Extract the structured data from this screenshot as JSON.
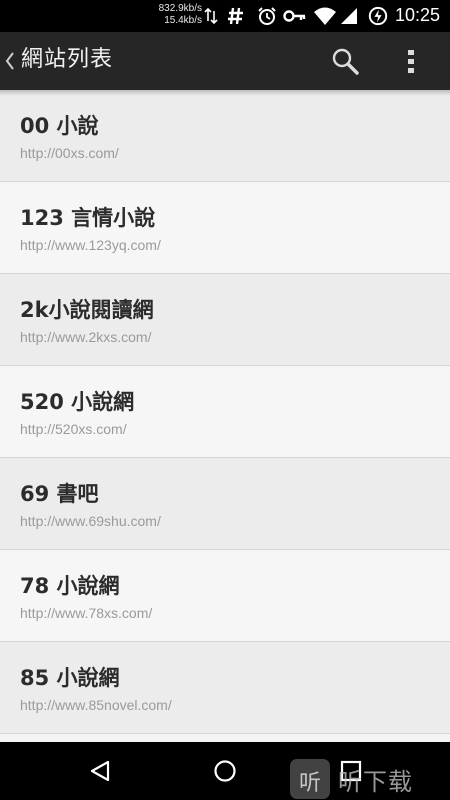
{
  "status_bar": {
    "speed_down": "832.9kb/s",
    "speed_up": "15.4kb/s",
    "time": "10:25",
    "icons": [
      "data-arrows-icon",
      "hash-icon",
      "alarm-icon",
      "vpn-key-icon",
      "wifi-icon",
      "signal-icon",
      "battery-charging-icon"
    ]
  },
  "action_bar": {
    "title": "網站列表",
    "back_icon": "chevron-left-icon",
    "search_icon": "search-icon",
    "overflow_icon": "overflow-menu-icon"
  },
  "sites": [
    {
      "name": "00 小說",
      "url": "http://00xs.com/"
    },
    {
      "name": "123 言情小說",
      "url": "http://www.123yq.com/"
    },
    {
      "name": "2k小說閱讀網",
      "url": "http://www.2kxs.com/"
    },
    {
      "name": "520 小說網",
      "url": "http://520xs.com/"
    },
    {
      "name": "69 書吧",
      "url": "http://www.69shu.com/"
    },
    {
      "name": "78 小說網",
      "url": "http://www.78xs.com/"
    },
    {
      "name": "85 小說網",
      "url": "http://www.85novel.com/"
    }
  ],
  "nav_bar": {
    "icons": [
      "nav-back-icon",
      "nav-home-icon",
      "nav-recents-icon"
    ]
  },
  "watermark": {
    "logo_glyph": "听",
    "text": "听下载"
  }
}
